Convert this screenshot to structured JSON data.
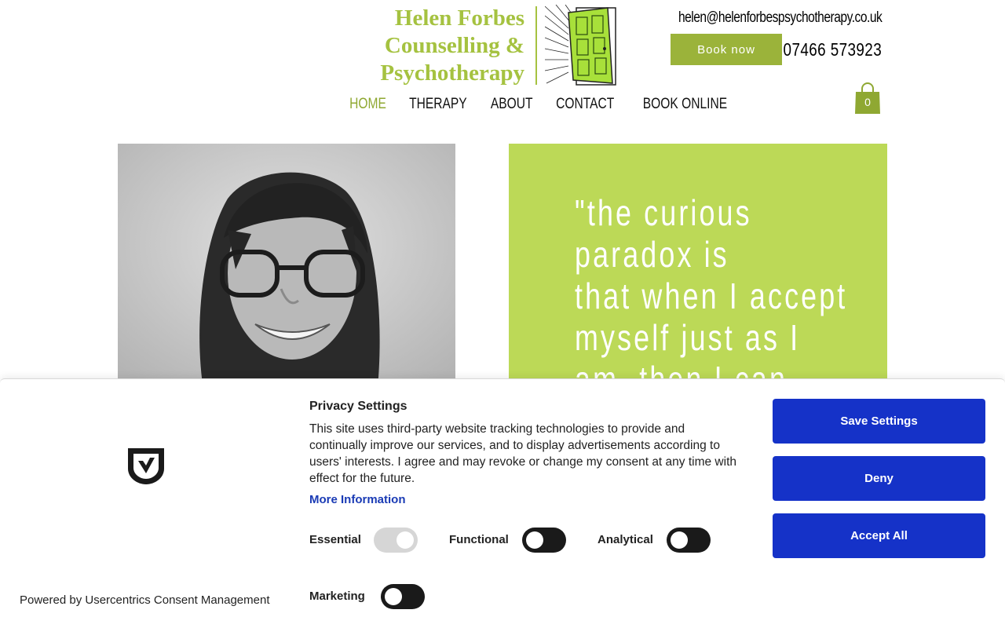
{
  "header": {
    "logo_lines": [
      "Helen Forbes",
      "Counselling &",
      "Psychotherapy"
    ],
    "email": "helen@helenforbespsychotherapy.co.uk",
    "book_button": "Book now",
    "phone": "07466 573923",
    "cart_count": "0"
  },
  "nav": {
    "items": [
      {
        "label": "HOME",
        "active": true
      },
      {
        "label": "THERAPY"
      },
      {
        "label": "ABOUT"
      },
      {
        "label": "CONTACT"
      },
      {
        "label": "BOOK ONLINE"
      }
    ]
  },
  "hero": {
    "quote_lines": [
      "\"the curious",
      "paradox is",
      "that when I accept",
      "myself just as I",
      "am, then I can"
    ]
  },
  "consent": {
    "title": "Privacy Settings",
    "body": "This site uses third-party website tracking technologies to provide and continually improve our services, and to display advertisements according to users' interests. I agree and may revoke or change my consent at any time with effect for the future.",
    "more_info": "More Information",
    "toggles": {
      "essential": "Essential",
      "functional": "Functional",
      "analytical": "Analytical",
      "marketing": "Marketing"
    },
    "powered_by": "Powered by Usercentrics Consent Management",
    "buttons": {
      "save": "Save Settings",
      "deny": "Deny",
      "accept": "Accept All"
    }
  },
  "colors": {
    "brand_green": "#a5c240",
    "quote_panel": "#bcd957",
    "consent_button": "#1532c8"
  }
}
